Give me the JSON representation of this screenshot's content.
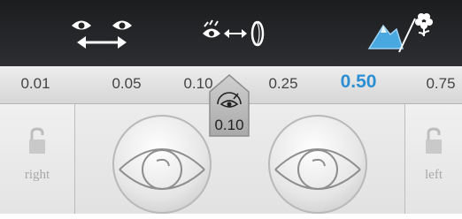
{
  "toolbar": {
    "modes": [
      {
        "icon": "eyes-distance-icon"
      },
      {
        "icon": "eye-lens-distance-icon"
      },
      {
        "icon": "landscape-flower-icon"
      }
    ]
  },
  "scale": {
    "values": [
      "0.01",
      "0.05",
      "0.10",
      "0.25",
      "0.50",
      "0.75"
    ],
    "selected": "0.50"
  },
  "marker": {
    "icon": "eye-gauge-icon",
    "value": "0.10"
  },
  "eyes": {
    "right_label": "right",
    "left_label": "left"
  },
  "colors": {
    "accent": "#2d8fd3",
    "toolbar_bg": "#222326"
  }
}
